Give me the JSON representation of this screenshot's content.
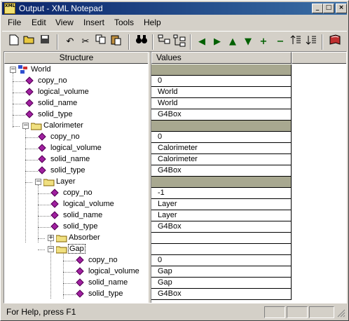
{
  "window": {
    "title": "Output - XML Notepad",
    "controls": {
      "minimize": "_",
      "maximize": "□",
      "close": "×"
    }
  },
  "menu": [
    "File",
    "Edit",
    "View",
    "Insert",
    "Tools",
    "Help"
  ],
  "toolbar": {
    "buttons": [
      "new-file",
      "open-folder",
      "save",
      "undo",
      "cut",
      "copy",
      "paste",
      "find",
      "insert-element",
      "insert-child",
      "move-left",
      "move-right",
      "move-up",
      "move-down",
      "add",
      "remove",
      "sort-up",
      "sort-down",
      "book"
    ]
  },
  "panes": {
    "structure_header": "Structure",
    "values_header": "Values"
  },
  "tree": [
    {
      "label": "World",
      "value": ""
    },
    {
      "label": "copy_no",
      "value": "0"
    },
    {
      "label": "logical_volume",
      "value": "World"
    },
    {
      "label": "solid_name",
      "value": "World"
    },
    {
      "label": "solid_type",
      "value": "G4Box"
    },
    {
      "label": "Calorimeter",
      "value": ""
    },
    {
      "label": "copy_no",
      "value": "0"
    },
    {
      "label": "logical_volume",
      "value": "Calorimeter"
    },
    {
      "label": "solid_name",
      "value": "Calorimeter"
    },
    {
      "label": "solid_type",
      "value": "G4Box"
    },
    {
      "label": "Layer",
      "value": ""
    },
    {
      "label": "copy_no",
      "value": "-1"
    },
    {
      "label": "logical_volume",
      "value": "Layer"
    },
    {
      "label": "solid_name",
      "value": "Layer"
    },
    {
      "label": "solid_type",
      "value": "G4Box"
    },
    {
      "label": "Absorber",
      "value": ""
    },
    {
      "label": "Gap",
      "value": ""
    },
    {
      "label": "copy_no",
      "value": "0"
    },
    {
      "label": "logical_volume",
      "value": "Gap"
    },
    {
      "label": "solid_name",
      "value": "Gap"
    },
    {
      "label": "solid_type",
      "value": "G4Box"
    }
  ],
  "status": {
    "text": "For Help, press F1"
  }
}
